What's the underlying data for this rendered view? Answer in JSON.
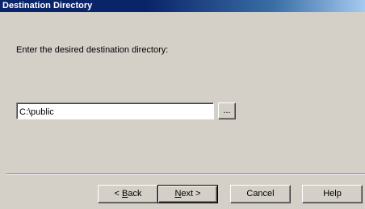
{
  "window": {
    "title": "Destination Directory"
  },
  "content": {
    "prompt": "Enter the desired destination directory:",
    "path_value": "C:\\public",
    "browse_label": "..."
  },
  "buttons": {
    "back": {
      "prefix": "< ",
      "mnemonic": "B",
      "rest": "ack"
    },
    "next": {
      "mnemonic": "N",
      "rest": "ext >"
    },
    "cancel": "Cancel",
    "help": "Help"
  },
  "colors": {
    "title_bar": "#0a246a",
    "title_bar_end": "#a6caf0",
    "face": "#d4d0c8"
  }
}
